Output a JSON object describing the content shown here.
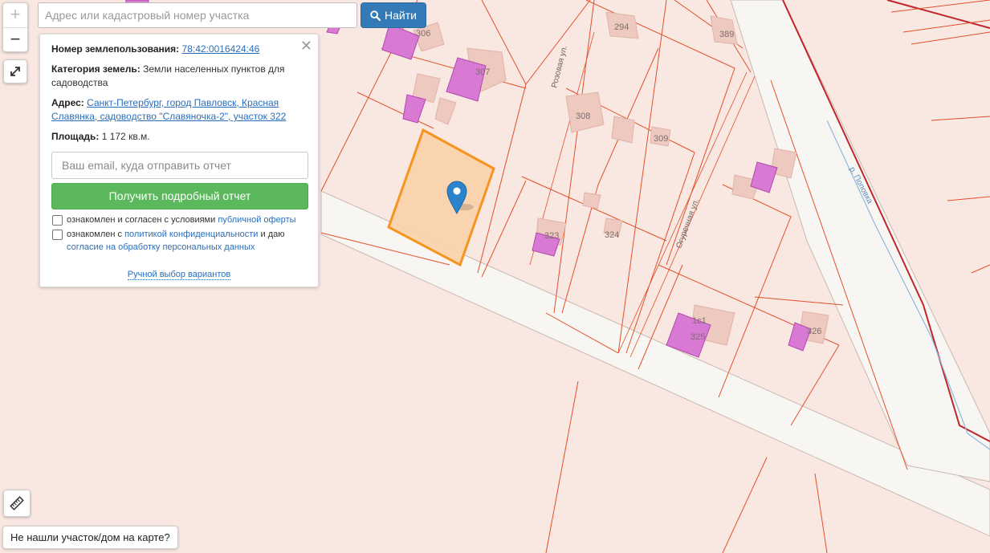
{
  "search": {
    "placeholder": "Адрес или кадастровый номер участка",
    "button_label": "Найти"
  },
  "zoom": {
    "in_label": "+",
    "out_label": "−"
  },
  "not_found_label": "Не нашли участок/дом на карте?",
  "panel": {
    "land_use_label": "Номер землепользования:",
    "land_use_value": "78:42:0016424:46",
    "category_label": "Категория земель:",
    "category_value": "Земли населенных пунктов для садоводства",
    "address_label": "Адрес:",
    "address_value": "Санкт-Петербург, город Павловск, Красная Славянка, садоводство \"Славяночка-2\", участок 322",
    "area_label": "Площадь:",
    "area_value": "1 172 кв.м.",
    "email_placeholder": "Ваш email, куда отправить отчет",
    "report_button": "Получить подробный отчет",
    "consent1_text": "ознакомлен и согласен с условиями",
    "consent1_link": "публичной оферты",
    "consent2_text_a": "ознакомлен с",
    "consent2_link_a": "политикой конфиденциальности",
    "consent2_text_b": "и даю",
    "consent2_link_b": "согласие на обработку персональных данных",
    "manual_link": "Ручной выбор вариантов"
  },
  "map": {
    "streets": [
      "Розовая ул.",
      "Огуречная ул.",
      "р. Поповка"
    ],
    "plot_numbers": [
      "306",
      "307",
      "294",
      "389",
      "308",
      "309",
      "323",
      "324",
      "325",
      "326",
      "1с1"
    ],
    "colors": {
      "background": "#f9e7e1",
      "boundary": "#e2502a",
      "selected": "#f5941e",
      "building": "#d879d4",
      "marker": "#2b83cb"
    }
  }
}
